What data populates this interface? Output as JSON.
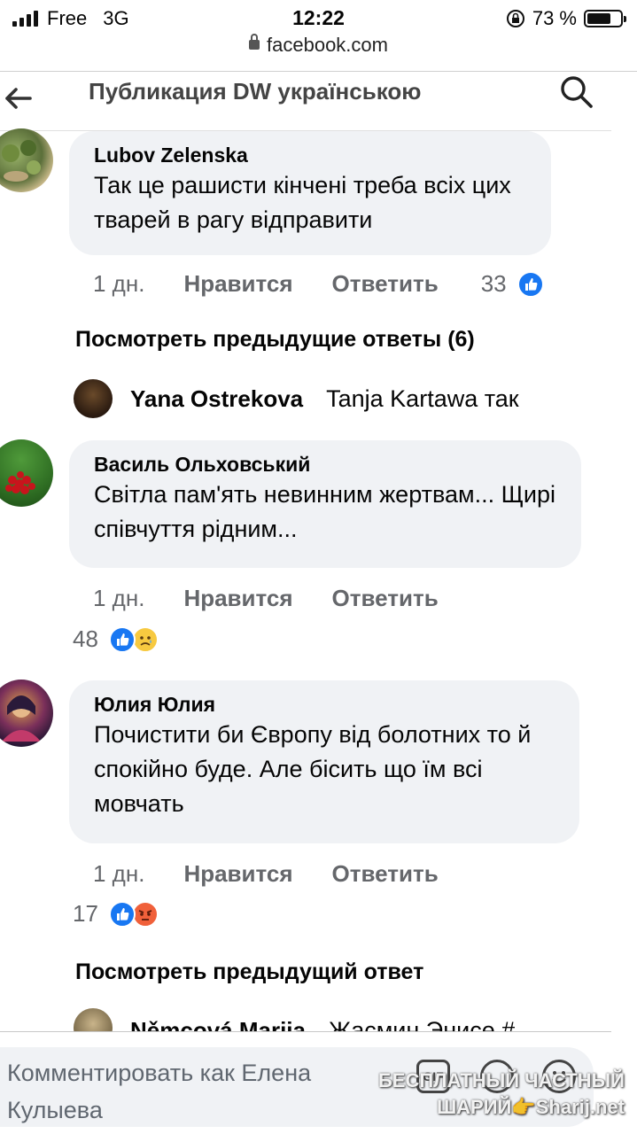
{
  "status_bar": {
    "carrier": "Free",
    "network": "3G",
    "time": "12:22",
    "battery": "73 %",
    "battery_level": 0.73
  },
  "browser": {
    "url": "facebook.com"
  },
  "header": {
    "title": "Публикация DW українською"
  },
  "comments": [
    {
      "author": "Lubov Zelenska",
      "text": "Так це рашисти кінчені треба всіх цих тварей в рагу відправити",
      "time": "1 дн.",
      "like_label": "Нравится",
      "reply_label": "Ответить",
      "reaction_count": "33",
      "reactions": [
        "like"
      ]
    },
    {
      "author": "Василь Ольховський",
      "text": "Світла пам'ять невинним жертвам... Щирі співчуття рідним...",
      "time": "1 дн.",
      "like_label": "Нравится",
      "reply_label": "Ответить",
      "reaction_count": "48",
      "reactions": [
        "like",
        "sad"
      ]
    },
    {
      "author": "Юлия Юлия",
      "text": "Почистити би Європу від болотних то й спокійно буде. Але бісить що їм всі мовчать",
      "time": "1 дн.",
      "like_label": "Нравится",
      "reply_label": "Ответить",
      "reaction_count": "17",
      "reactions": [
        "like",
        "angry"
      ]
    }
  ],
  "previous_replies_1": "Посмотреть предыдущие ответы (6)",
  "reply_preview_1": {
    "author": "Yana Ostrekova",
    "text": "Tanja Kartawa так"
  },
  "previous_replies_2": "Посмотреть предыдущий ответ",
  "reply_preview_2": {
    "author": "Němcová Marija",
    "text": "Жасмин Энисе #"
  },
  "composer": {
    "placeholder": "Комментировать как Елена Кулыева",
    "gif_label": "GIF"
  },
  "watermark": {
    "line1": "БЕСПЛАТНЫЙ ЧАСТНЫЙ",
    "line2": "ШАРИЙ👉Sharij.net"
  }
}
